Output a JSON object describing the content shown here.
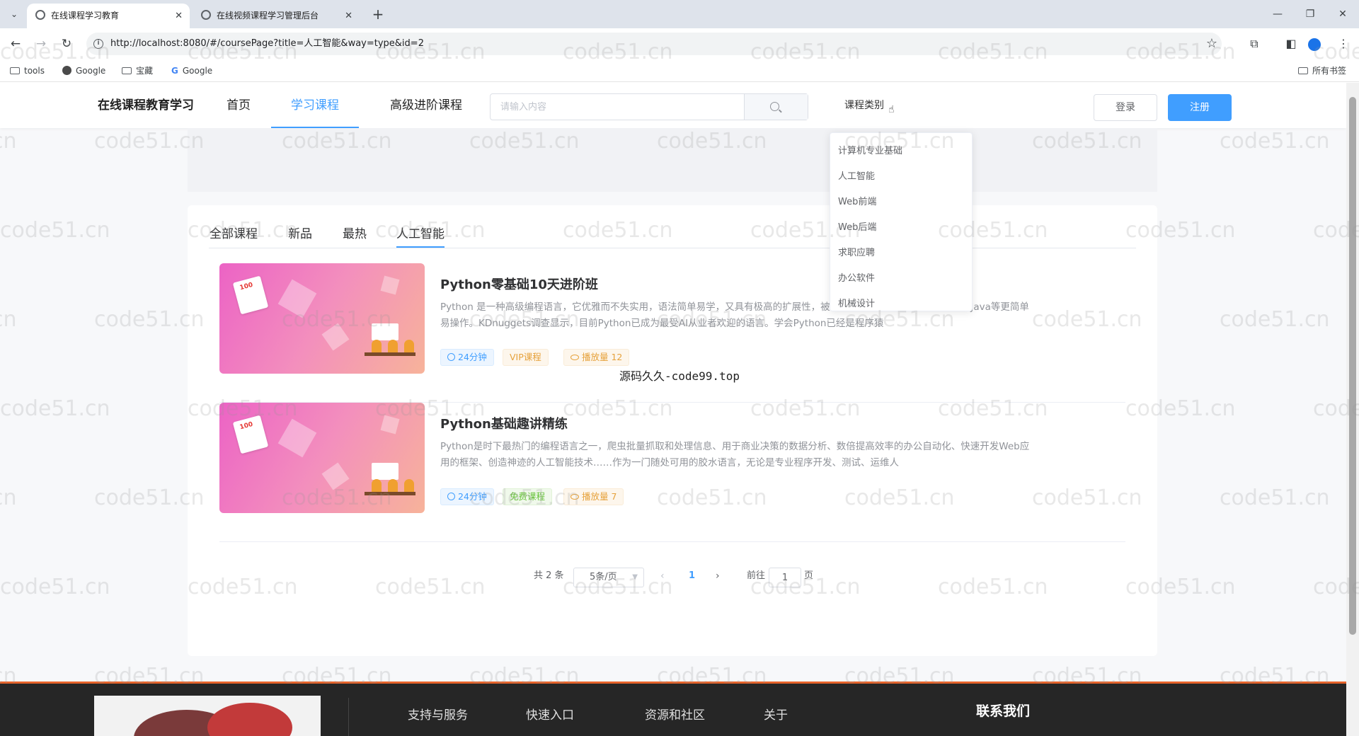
{
  "browser": {
    "tabs": [
      {
        "title": "在线课程学习教育",
        "active": true
      },
      {
        "title": "在线视频课程学习管理后台",
        "active": false
      }
    ],
    "url": "http://localhost:8080/#/coursePage?title=人工智能&way=type&id=2",
    "bookmarks": [
      "tools",
      "Google",
      "宝藏",
      "Google"
    ],
    "all_bookmarks": "所有书签"
  },
  "header": {
    "brand": "在线课程教育学习",
    "nav": [
      "首页",
      "学习课程",
      "高级进阶课程"
    ],
    "search_placeholder": "请输入内容",
    "category_label": "课程类别",
    "login": "登录",
    "register": "注册"
  },
  "categories": [
    "计算机专业基础",
    "人工智能",
    "Web前端",
    "Web后端",
    "求职应聘",
    "办公软件",
    "机械设计"
  ],
  "filters": [
    "全部课程",
    "新品",
    "最热",
    "人工智能"
  ],
  "courses": [
    {
      "title": "Python零基础10天进阶班",
      "desc": "Python 是一种高级编程语言，它优雅而不失实用，语法简单易学，又具有极高的扩展性，被誉为编程界的“编程明星” C++和Java等更简单易操作。KDnuggets调查显示，目前Python已成为最受AI从业者欢迎的语言。学会Python已经是程序猿",
      "duration": "24分钟",
      "type_tag": "VIP课程",
      "plays": "播放量 12"
    },
    {
      "title": "Python基础趣讲精练",
      "desc": "Python是时下最热门的编程语言之一，爬虫批量抓取和处理信息、用于商业决策的数据分析、数倍提高效率的办公自动化、快速开发Web应用的框架、创造神迹的人工智能技术……作为一门随处可用的胶水语言，无论是专业程序开发、测试、运维人",
      "duration": "24分钟",
      "type_tag": "免费课程",
      "plays": "播放量 7"
    }
  ],
  "overlay": "源码久久-code99.top",
  "pagination": {
    "total": "共 2 条",
    "page_size": "5条/页",
    "current": "1",
    "goto": "前往",
    "goto_value": "1",
    "page_unit": "页"
  },
  "footer": {
    "links": [
      "支持与服务",
      "快速入口",
      "资源和社区",
      "关于"
    ],
    "contact": "联系我们"
  },
  "watermark": "code51.cn",
  "colors": {
    "accent": "#409eff",
    "footer_bg": "#262626",
    "footer_border": "#e6632a"
  }
}
